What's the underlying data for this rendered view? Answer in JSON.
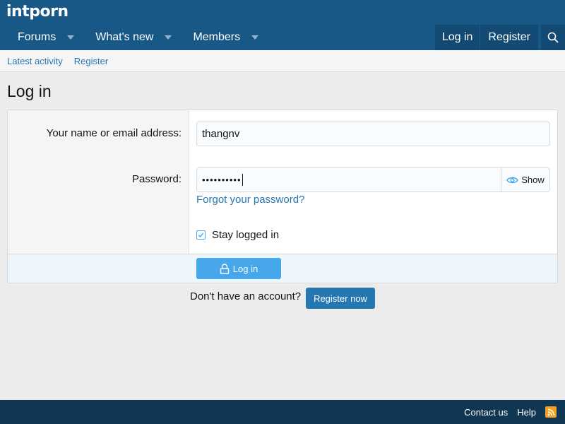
{
  "header": {
    "logo": "intporn",
    "nav": [
      {
        "label": "Forums"
      },
      {
        "label": "What's new"
      },
      {
        "label": "Members"
      }
    ],
    "login_label": "Log in",
    "register_label": "Register",
    "search_icon": "search-icon"
  },
  "subnav": {
    "items": [
      {
        "label": "Latest activity"
      },
      {
        "label": "Register"
      }
    ]
  },
  "page": {
    "title": "Log in"
  },
  "form": {
    "name_label": "Your name or email address:",
    "name_value": "thangnv",
    "password_label": "Password:",
    "password_mask": "••••••••••",
    "show_label": "Show",
    "forgot_label": "Forgot your password?",
    "stay_logged_label": "Stay logged in",
    "stay_logged_checked": true,
    "submit_label": "Log in"
  },
  "register_prompt": {
    "text": "Don't have an account?",
    "button_label": "Register now"
  },
  "footer": {
    "contact_label": "Contact us",
    "help_label": "Help",
    "rss_icon": "rss-icon"
  },
  "colors": {
    "header_bg": "#185886",
    "nav_button_bg": "#124a73",
    "link": "#2577b1",
    "primary_button": "#47a7eb",
    "footer_bg": "#0f3652",
    "rss": "#f6a023"
  }
}
